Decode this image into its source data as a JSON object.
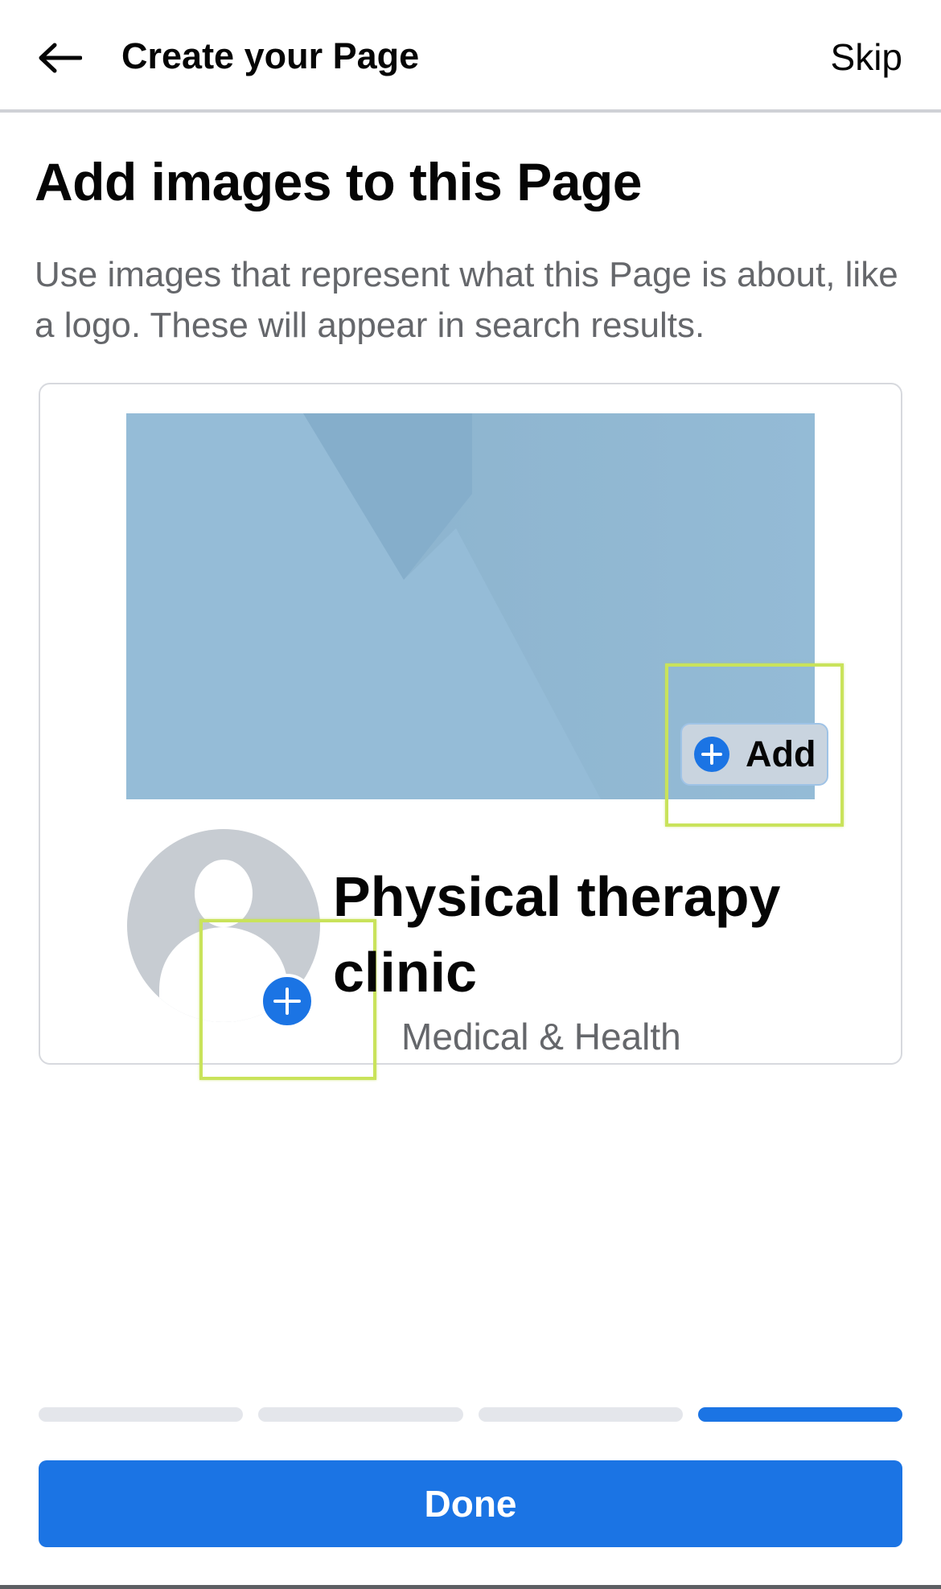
{
  "header": {
    "title": "Create your Page",
    "skip_label": "Skip",
    "back_icon": "arrow-left-icon"
  },
  "main": {
    "headline": "Add images to this Page",
    "description": "Use images that represent what this Page is about, like a logo. These will appear in search results."
  },
  "preview": {
    "cover_add_label": "Add",
    "page_name": "Physical therapy clinic",
    "category": "Medical & Health",
    "cover_color": "#94bbd6",
    "avatar_color": "#c7ccd2"
  },
  "progress": {
    "steps_total": 4,
    "current_step": 4
  },
  "footer": {
    "done_label": "Done"
  },
  "colors": {
    "accent": "#1b74e4",
    "highlight": "#c9e35b",
    "secondary_text": "#65676b"
  }
}
